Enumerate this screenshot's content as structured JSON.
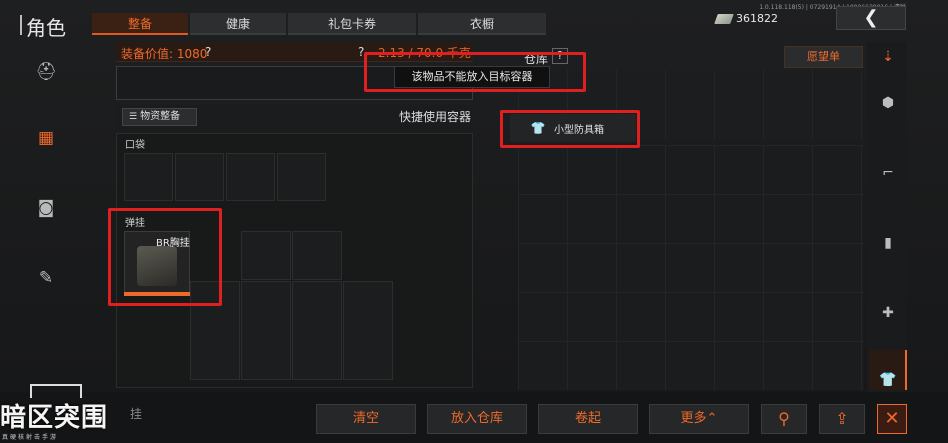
{
  "header": {
    "title": "角色",
    "tabs": [
      {
        "label": "整备",
        "active": true
      },
      {
        "label": "健康",
        "active": false
      },
      {
        "label": "礼包卡券",
        "active": false
      },
      {
        "label": "衣橱",
        "active": false
      }
    ],
    "version": "1.0.118.118(5) | 07291914 | 10906638016 | 清晰",
    "currency_amount": "361822",
    "back_icon": "chevron-left-icon"
  },
  "left_rail": {
    "icons": [
      "helmet-icon",
      "vest-icon",
      "backpack-icon",
      "wrench-icon"
    ],
    "active_index": 1
  },
  "loadout": {
    "equip_value_label": "装备价值: 1080",
    "help_mark": "?",
    "capacity_text": "2.13 / 70.0 千克",
    "supply_button": "物资整备",
    "quick_use": "快捷使用容器",
    "pocket_label": "口袋",
    "rig_label": "弹挂",
    "rig_item_name": "BR胸挂"
  },
  "warehouse": {
    "label": "仓库",
    "help_mark": "?",
    "wishlist_button": "愿望单",
    "container_item": "小型防具箱",
    "tooltip": "该物品不能放入目标容器"
  },
  "right_rail": {
    "icons": [
      "sort-icon",
      "cube-icon",
      "rifle-icon",
      "ammo-icon",
      "medkit-icon",
      "shirt-icon"
    ],
    "active_index": 5
  },
  "bottom_bar": {
    "clear": "清空",
    "store": "放入仓库",
    "roll": "卷起",
    "more": "更多⌃",
    "hang_label": "挂",
    "search_icon": "search-icon",
    "share_icon": "share-icon",
    "close_icon": "close-icon"
  },
  "watermark": {
    "logo": "暗区突围",
    "sub": "真硬核射击手游"
  },
  "colors": {
    "accent": "#ef6a2a",
    "highlight": "#e02020"
  }
}
